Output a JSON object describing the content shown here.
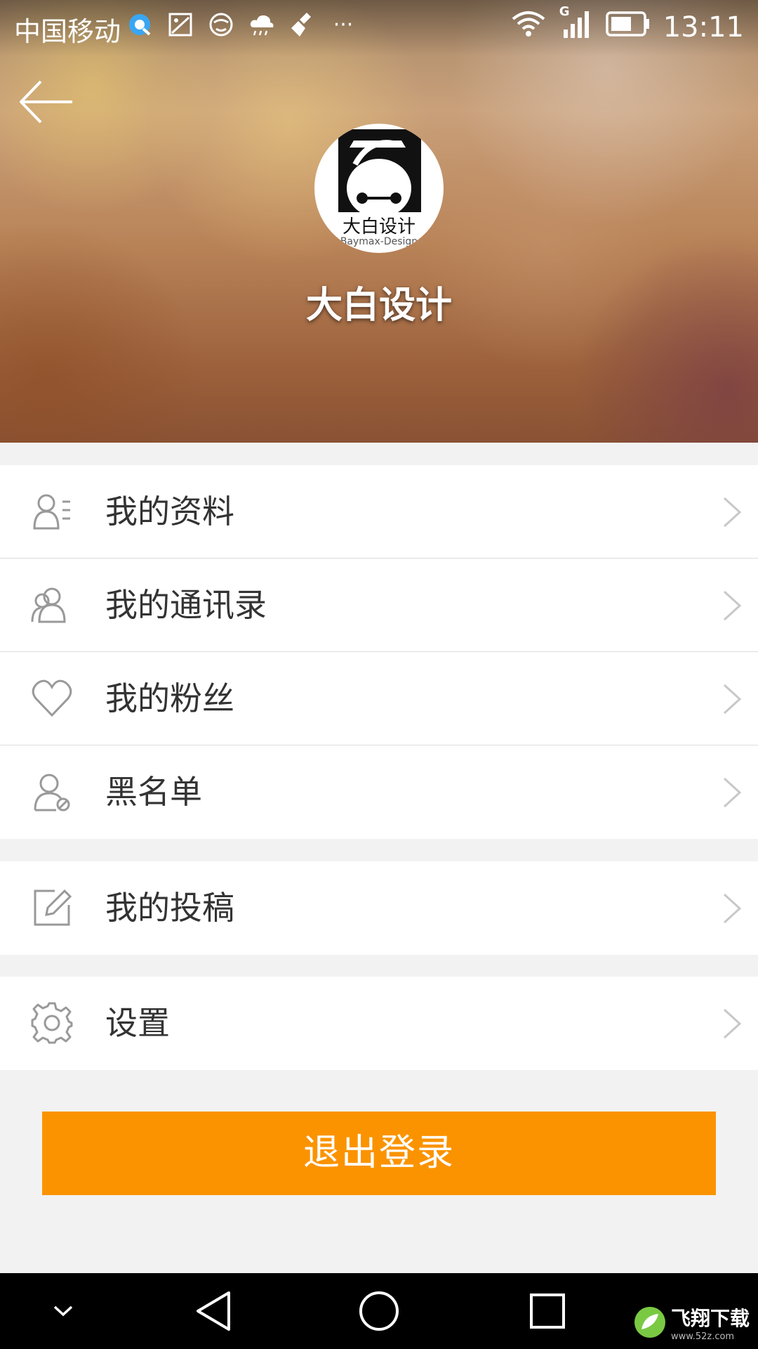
{
  "status_bar": {
    "carrier": "中国移动",
    "icons": [
      "browser-icon",
      "gallery-icon",
      "face-icon",
      "weather-icon",
      "cleaner-icon",
      "more-dots-icon"
    ],
    "more": "···",
    "network_type": "G",
    "time": "13:11"
  },
  "profile": {
    "name": "大白设计",
    "avatar_text": "大白设计",
    "avatar_subtext": "Baymax-Design"
  },
  "menu": {
    "group1": [
      {
        "label": "我的资料",
        "icon": "profile-info-icon"
      },
      {
        "label": "我的通讯录",
        "icon": "contacts-icon"
      },
      {
        "label": "我的粉丝",
        "icon": "heart-icon"
      },
      {
        "label": "黑名单",
        "icon": "blocked-user-icon"
      }
    ],
    "group2": [
      {
        "label": "我的投稿",
        "icon": "edit-icon"
      }
    ],
    "group3": [
      {
        "label": "设置",
        "icon": "gear-icon"
      }
    ]
  },
  "logout_label": "退出登录",
  "watermark": {
    "title": "飞翔下载",
    "url": "www.52z.com"
  },
  "colors": {
    "accent": "#fb9300",
    "background": "#f2f2f2",
    "text": "#333333"
  }
}
